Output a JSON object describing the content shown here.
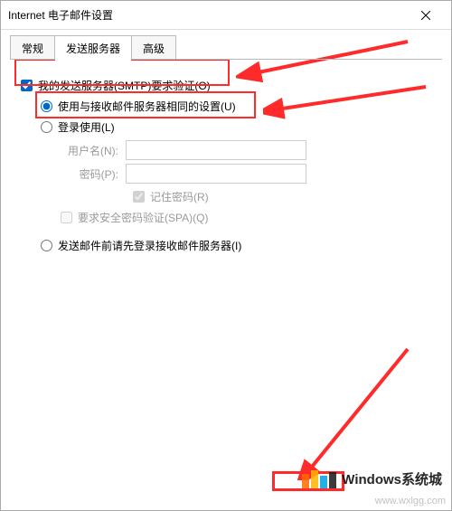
{
  "window": {
    "title": "Internet 电子邮件设置"
  },
  "tabs": {
    "general": "常规",
    "outgoing": "发送服务器",
    "advanced": "高级"
  },
  "form": {
    "smtp_auth_label": "我的发送服务器(SMTP)要求验证(O)",
    "same_as_incoming_label": "使用与接收邮件服务器相同的设置(U)",
    "logon_using_label": "登录使用(L)",
    "username_label": "用户名(N):",
    "password_label": "密码(P):",
    "remember_password_label": "记住密码(R)",
    "spa_label": "要求安全密码验证(SPA)(Q)",
    "login_first_label": "发送邮件前请先登录接收邮件服务器(I)",
    "username_value": "",
    "password_value": ""
  },
  "watermark": {
    "text": "Windows系统城",
    "url": "www.wxlgg.com"
  }
}
